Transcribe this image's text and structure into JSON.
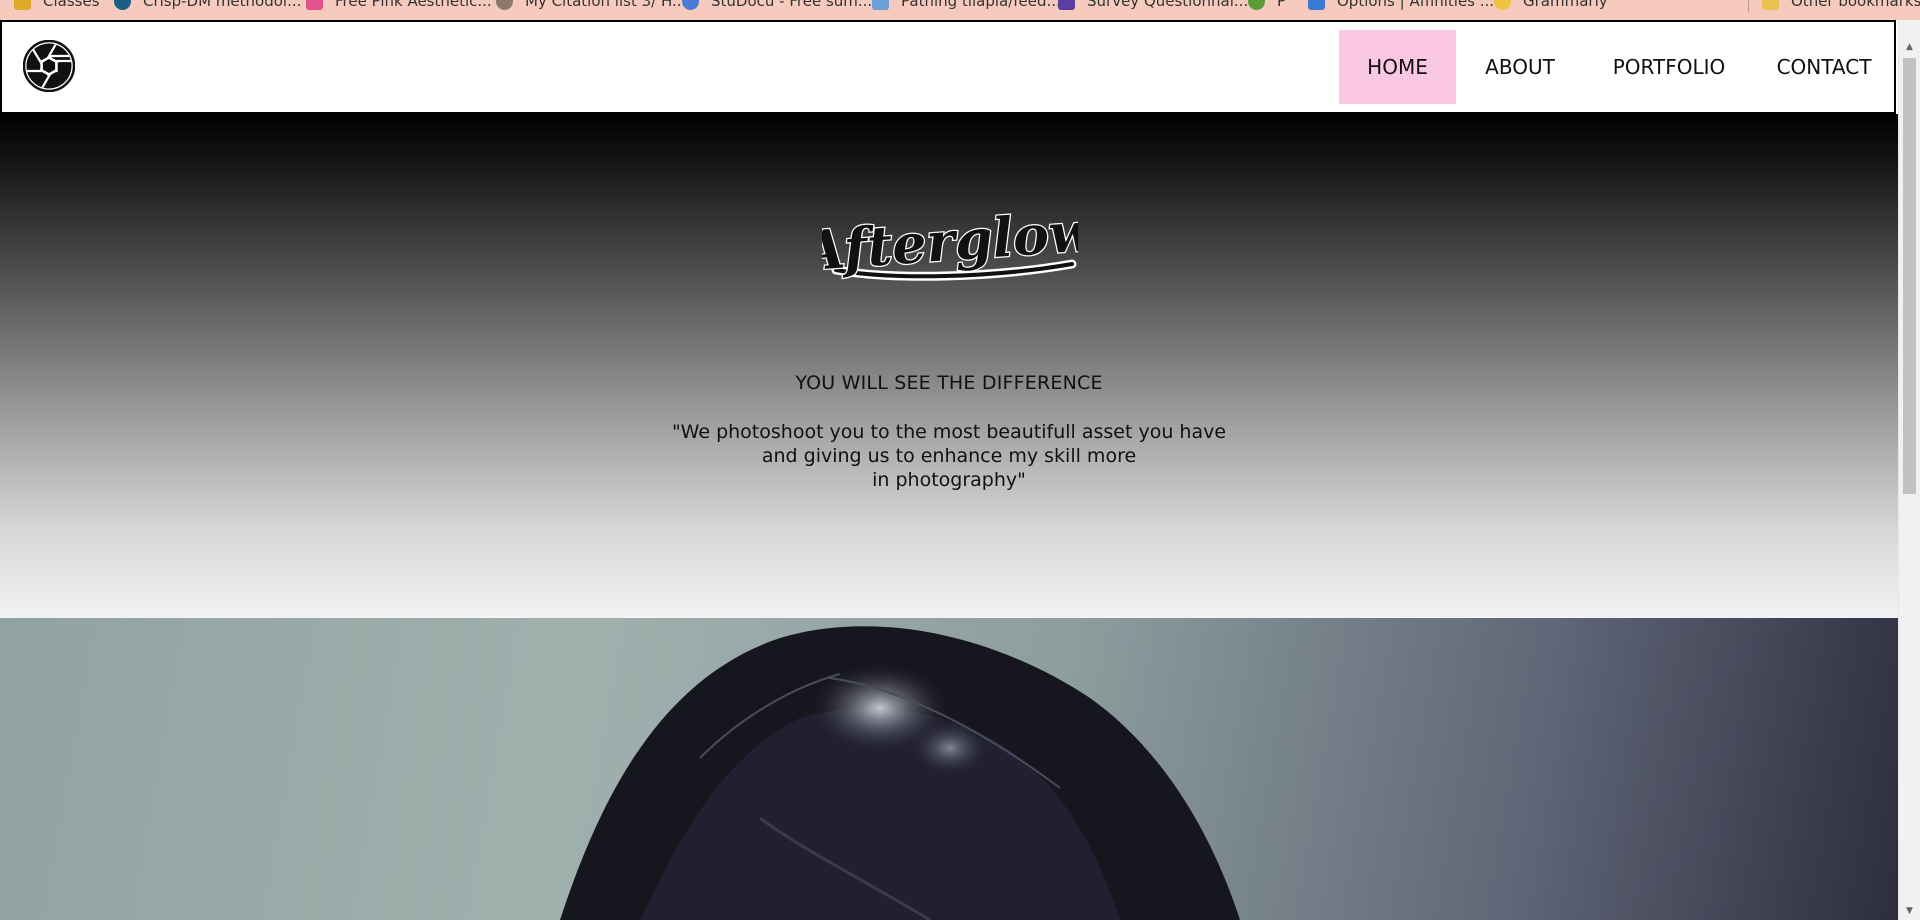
{
  "bookmarks": [
    {
      "label": "Classes",
      "color": "#e0a92a"
    },
    {
      "label": "Crisp-DM methodol...",
      "color": "#1c5f86"
    },
    {
      "label": "Free Pink Aesthetic...",
      "color": "#e0538f"
    },
    {
      "label": "My Citation list 3/ H...",
      "color": "#8a7a6a"
    },
    {
      "label": "StuDocu - Free sum...",
      "color": "#4b7bd8"
    },
    {
      "label": "Pathing tilapia/feed...",
      "color": "#6aa0d8"
    },
    {
      "label": "Survey Questionnai...",
      "color": "#5a3fa0"
    },
    {
      "label": "P",
      "color": "#5a9c3a"
    },
    {
      "label": "Options | Affinities ...",
      "color": "#3c7ad8"
    },
    {
      "label": "Grammarly",
      "color": "#f0c43a"
    },
    {
      "label": "Other bookmarks",
      "color": "#e8c150"
    }
  ],
  "nav": {
    "items": [
      {
        "label": "HOME",
        "active": true
      },
      {
        "label": "ABOUT",
        "active": false
      },
      {
        "label": "PORTFOLIO",
        "active": false
      },
      {
        "label": "CONTACT",
        "active": false
      }
    ],
    "active_color": "#fbc8e3"
  },
  "hero": {
    "brand": "Afterglow",
    "tagline": "YOU WILL SEE THE DIFFERENCE",
    "quote_lines": [
      "\"We photoshoot you to the most beautifull asset you have",
      "and giving us to enhance my skill more",
      "in photography\""
    ]
  },
  "icons": {
    "site_logo": "camera-aperture-icon",
    "scroll_up": "scroll-up-arrow-icon",
    "scroll_down": "scroll-down-arrow-icon"
  }
}
